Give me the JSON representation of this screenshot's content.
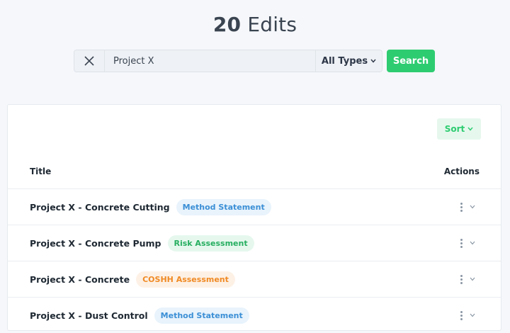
{
  "header": {
    "count": "20",
    "label": "Edits"
  },
  "search": {
    "value": "Project X",
    "placeholder": "",
    "type_filter": "All Types",
    "button_label": "Search"
  },
  "list": {
    "sort_label": "Sort",
    "columns": {
      "title": "Title",
      "actions": "Actions"
    },
    "rows": [
      {
        "title": "Project X - Concrete Cutting",
        "type": "Method Statement"
      },
      {
        "title": "Project X - Concrete Pump",
        "type": "Risk Assessment"
      },
      {
        "title": "Project X - Concrete",
        "type": "COSHH Assessment"
      },
      {
        "title": "Project X - Dust Control",
        "type": "Method Statement"
      }
    ]
  },
  "icons": {
    "clear": "close-icon",
    "dropdown": "chevron-down-icon",
    "more": "more-vertical-icon"
  },
  "colors": {
    "accent": "#2ecc71",
    "method_statement": "#3b8fd6",
    "risk_assessment": "#27ae60",
    "coshh_assessment": "#f08a24"
  }
}
